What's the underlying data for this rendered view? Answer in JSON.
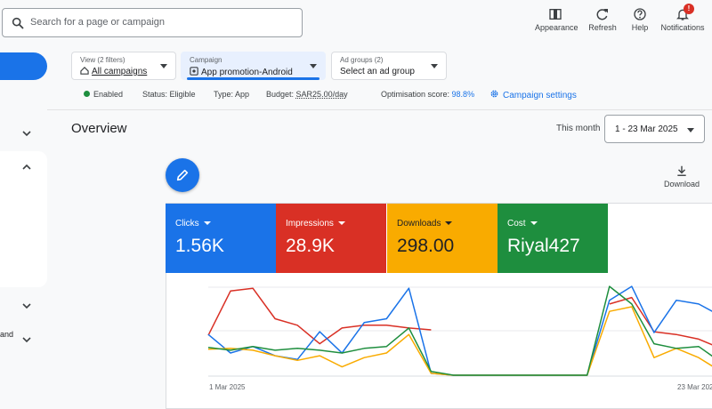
{
  "search": {
    "placeholder": "Search for a page or campaign"
  },
  "toolbar": {
    "appearance": "Appearance",
    "refresh": "Refresh",
    "help": "Help",
    "notifications": "Notifications",
    "notification_badge": "!"
  },
  "nav": {
    "partial_text": "and"
  },
  "filters": {
    "view": {
      "label": "View (2 filters)",
      "value": "All campaigns"
    },
    "campaign": {
      "label": "Campaign",
      "value": "App promotion-Android"
    },
    "adgroups": {
      "label": "Ad groups (2)",
      "value": "Select an ad group"
    }
  },
  "status": {
    "enabled": "Enabled",
    "status_label": "Status:",
    "status_value": "Eligible",
    "type_label": "Type:",
    "type_value": "App",
    "budget_label": "Budget:",
    "budget_value": "SAR25.00/day",
    "opt_label": "Optimisation score:",
    "opt_value": "98.8%",
    "settings": "Campaign settings"
  },
  "overview": {
    "title": "Overview",
    "period_label": "This month",
    "date_range": "1 - 23 Mar 2025",
    "download": "Download"
  },
  "metrics": [
    {
      "name": "Clicks",
      "value": "1.56K",
      "color": "#1a73e8"
    },
    {
      "name": "Impressions",
      "value": "28.9K",
      "color": "#d93025"
    },
    {
      "name": "Downloads",
      "value": "298.00",
      "color": "#f9ab00"
    },
    {
      "name": "Cost",
      "value": "Riyal427",
      "color": "#1e8e3e"
    }
  ],
  "chart": {
    "x_start": "1 Mar 2025",
    "x_end": "23 Mar 2025",
    "series": [
      {
        "color": "#d93025",
        "values": [
          0.44,
          0.92,
          0.95,
          0.62,
          0.55,
          0.35,
          0.52,
          0.55,
          0.55,
          0.52,
          0.5,
          null,
          null,
          null,
          null,
          null,
          null,
          null,
          0.78,
          0.85,
          0.48,
          0.45,
          0.4,
          0.3
        ]
      },
      {
        "color": "#1a73e8",
        "values": [
          0.45,
          0.25,
          0.32,
          0.22,
          0.18,
          0.48,
          0.25,
          0.58,
          0.62,
          0.95,
          0.03,
          0.01,
          0.01,
          0.01,
          0.01,
          0.01,
          0.01,
          0.01,
          0.82,
          0.97,
          0.47,
          0.82,
          0.78,
          0.65
        ]
      },
      {
        "color": "#f9ab00",
        "values": [
          0.29,
          0.3,
          0.28,
          0.22,
          0.17,
          0.22,
          0.1,
          0.2,
          0.25,
          0.45,
          0.03,
          0.01,
          0.01,
          0.01,
          0.01,
          0.01,
          0.01,
          0.01,
          0.7,
          0.75,
          0.2,
          0.3,
          0.2,
          0.05
        ]
      },
      {
        "color": "#1e8e3e",
        "values": [
          0.31,
          0.28,
          0.32,
          0.28,
          0.3,
          0.28,
          0.25,
          0.3,
          0.32,
          0.52,
          0.05,
          0.01,
          0.01,
          0.01,
          0.01,
          0.01,
          0.01,
          0.01,
          0.97,
          0.78,
          0.35,
          0.3,
          0.32,
          0.15
        ]
      }
    ]
  }
}
